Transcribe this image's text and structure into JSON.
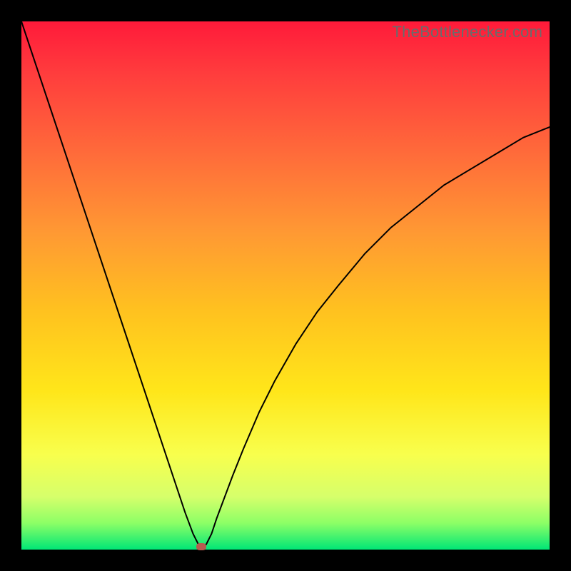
{
  "watermark": "TheBottlenecker.com",
  "chart_data": {
    "type": "line",
    "title": "",
    "xlabel": "",
    "ylabel": "",
    "xlim": [
      0,
      100
    ],
    "ylim": [
      0,
      100
    ],
    "x": [
      0,
      2,
      5,
      8,
      11,
      14,
      17,
      20,
      23,
      26,
      29,
      31,
      32.5,
      33.5,
      34,
      34.5,
      35,
      36,
      37,
      38.5,
      40,
      42,
      45,
      48,
      52,
      56,
      60,
      65,
      70,
      75,
      80,
      85,
      90,
      95,
      100
    ],
    "y": [
      100,
      94,
      85,
      76,
      67,
      58,
      49,
      40,
      31,
      22,
      13,
      7,
      3,
      1,
      0.5,
      0.5,
      1,
      3,
      6,
      10,
      14,
      19,
      26,
      32,
      39,
      45,
      50,
      56,
      61,
      65,
      69,
      72,
      75,
      78,
      80
    ],
    "marker": {
      "x": 34,
      "y": 0.5
    },
    "gradient_stops": [
      {
        "pos": 0,
        "color": "#ff1a3a"
      },
      {
        "pos": 25,
        "color": "#ff6b3a"
      },
      {
        "pos": 55,
        "color": "#ffc21f"
      },
      {
        "pos": 82,
        "color": "#f8ff4d"
      },
      {
        "pos": 100,
        "color": "#00e676"
      }
    ]
  }
}
